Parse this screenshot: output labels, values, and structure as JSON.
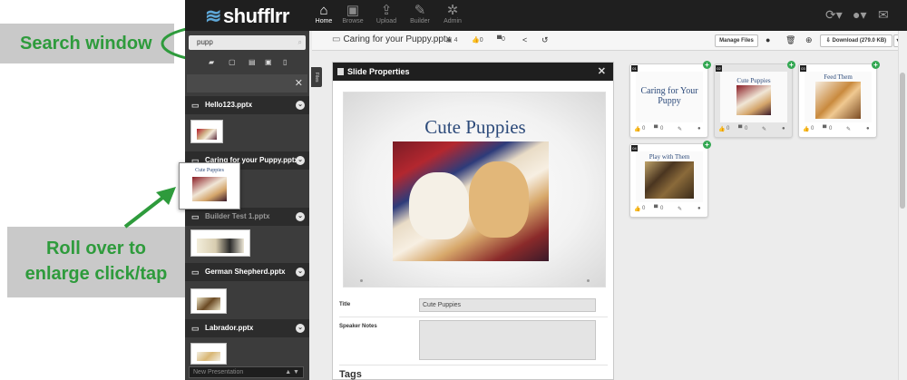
{
  "annotations": {
    "search_callout": "Search window",
    "rollover_callout_line1": "Roll over to",
    "rollover_callout_line2": "enlarge click/tap",
    "accent_color": "#2e9b3c"
  },
  "app": {
    "logo": "shufflrr",
    "nav": [
      {
        "label": "Home",
        "icon": "home-icon",
        "active": true
      },
      {
        "label": "Browse",
        "icon": "browse-icon"
      },
      {
        "label": "Upload",
        "icon": "upload-icon"
      },
      {
        "label": "Builder",
        "icon": "wrench-icon"
      },
      {
        "label": "Admin",
        "icon": "gear-icon"
      }
    ],
    "topright_icons": [
      "sync-icon",
      "user-icon",
      "mail-icon"
    ]
  },
  "sidebar": {
    "search_value": "pupp",
    "files": [
      {
        "name": "Hello123.pptx"
      },
      {
        "name": "Caring for your Puppy.pptx"
      },
      {
        "name": "Builder Test 1.pptx"
      },
      {
        "name": "German Shepherd.pptx"
      },
      {
        "name": "Labrador.pptx"
      }
    ],
    "files_tab": "Files",
    "new_presentation_placeholder": "New Presentation"
  },
  "toolbar": {
    "doc_title": "Caring for your Puppy.pptx",
    "slide_count": "4",
    "likes": "0",
    "comments": "0",
    "manage_files": "Manage Files",
    "download": "Download (279.0 KB)"
  },
  "slide_properties": {
    "header": "Slide Properties",
    "preview_title": "Cute Puppies",
    "title_label": "Title",
    "title_value": "Cute Puppies",
    "notes_label": "Speaker Notes",
    "notes_value": "",
    "tags_label": "Tags"
  },
  "slides": [
    {
      "num": "01",
      "title": "Caring for Your Puppy",
      "likes": "0",
      "comments": "0"
    },
    {
      "num": "02",
      "title": "Cute Puppies",
      "likes": "0",
      "comments": "0"
    },
    {
      "num": "03",
      "title": "Feed Them",
      "likes": "0",
      "comments": "0"
    },
    {
      "num": "04",
      "title": "Play with Them",
      "likes": "0",
      "comments": "0"
    }
  ],
  "hover_preview": {
    "title": "Cute Puppies"
  }
}
